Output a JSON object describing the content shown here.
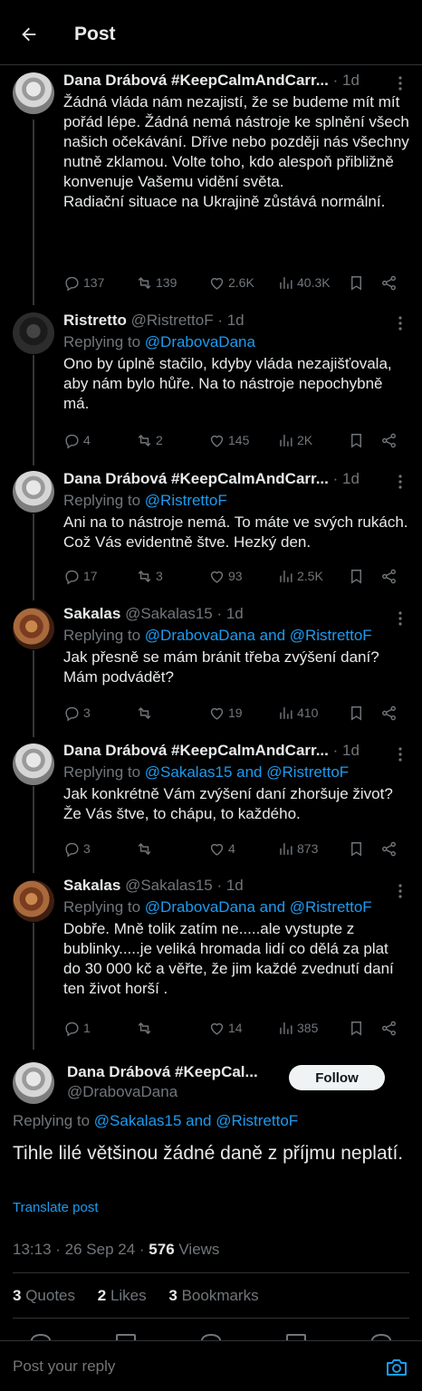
{
  "header": {
    "title": "Post"
  },
  "tweets": [
    {
      "name": "Dana Drábová #KeepCalmAndCarr...",
      "handle": "",
      "time": "· 1d",
      "reply_to_prefix": "",
      "reply_to_links": "",
      "text": "Žádná vláda nám nezajistí, že se budeme mít mít pořád lépe. Žádná nemá nástroje ke splnění všech našich očekávání. Dříve nebo později nás všechny nutně zklamou. Volte toho, kdo alespoň přibližně konvenuje Vašemu vidění světa.\nRadiační situace na Ukrajině zůstává normální.",
      "replies": "137",
      "retweets": "139",
      "likes": "2.6K",
      "views": "40.3K"
    },
    {
      "name": "Ristretto",
      "handle": "@RistrettoF",
      "time": "· 1d",
      "reply_to_prefix": "Replying to ",
      "reply_to_links": "@DrabovaDana",
      "text": "Ono by úplně stačilo, kdyby vláda nezajišťovala, aby nám bylo hůře. Na to nástroje nepochybně má.",
      "replies": "4",
      "retweets": "2",
      "likes": "145",
      "views": "2K"
    },
    {
      "name": "Dana Drábová #KeepCalmAndCarr...",
      "handle": "",
      "time": "· 1d",
      "reply_to_prefix": "Replying to ",
      "reply_to_links": "@RistrettoF",
      "text": "Ani na to nástroje nemá. To máte ve svých rukách. Což Vás evidentně štve. Hezký den.",
      "replies": "17",
      "retweets": "3",
      "likes": "93",
      "views": "2.5K"
    },
    {
      "name": "Sakalas",
      "handle": "@Sakalas15",
      "time": "· 1d",
      "reply_to_prefix": "Replying to ",
      "reply_to_links": "@DrabovaDana and @RistrettoF",
      "text": "Jak přesně se mám bránit třeba zvýšení daní? Mám podvádět?",
      "replies": "3",
      "retweets": "",
      "likes": "19",
      "views": "410"
    },
    {
      "name": "Dana Drábová #KeepCalmAndCarr...",
      "handle": "",
      "time": "· 1d",
      "reply_to_prefix": "Replying to ",
      "reply_to_links": "@Sakalas15 and @RistrettoF",
      "text": "Jak konkrétně Vám zvýšení daní zhoršuje život? Že Vás štve, to chápu, to každého.",
      "replies": "3",
      "retweets": "",
      "likes": "4",
      "views": "873"
    },
    {
      "name": "Sakalas",
      "handle": "@Sakalas15",
      "time": "· 1d",
      "reply_to_prefix": "Replying to ",
      "reply_to_links": "@DrabovaDana and @RistrettoF",
      "text": "Dobře. Mně tolik zatím ne.....ale vystupte z bublinky.....je veliká  hromada lidí co dělá za plat do 30 000 kč a věřte, že jim každé zvednutí daní ten život horší .",
      "replies": "1",
      "retweets": "",
      "likes": "14",
      "views": "385"
    }
  ],
  "main_post": {
    "name": "Dana Drábová #KeepCal...",
    "handle": "@DrabovaDana",
    "follow_label": "Follow",
    "reply_to_prefix": "Replying to ",
    "reply_to_links": "@Sakalas15 and @RistrettoF",
    "text": "Tihle lilé většinou žádné daně z příjmu neplatí.",
    "translate_label": "Translate post",
    "timestamp": "13:13 · 26 Sep 24 · ",
    "views_count": "576",
    "views_label": " Views",
    "quotes_count": "3",
    "quotes_label": " Quotes",
    "likes_count": "2",
    "likes_label": " Likes",
    "bookmarks_count": "3",
    "bookmarks_label": " Bookmarks"
  },
  "reply_bar": {
    "placeholder": "Post your reply"
  },
  "colors": {
    "accent": "#1d9bf0",
    "muted": "#71767b",
    "text": "#e7e9ea",
    "background": "#000000",
    "divider": "#2f3336"
  }
}
